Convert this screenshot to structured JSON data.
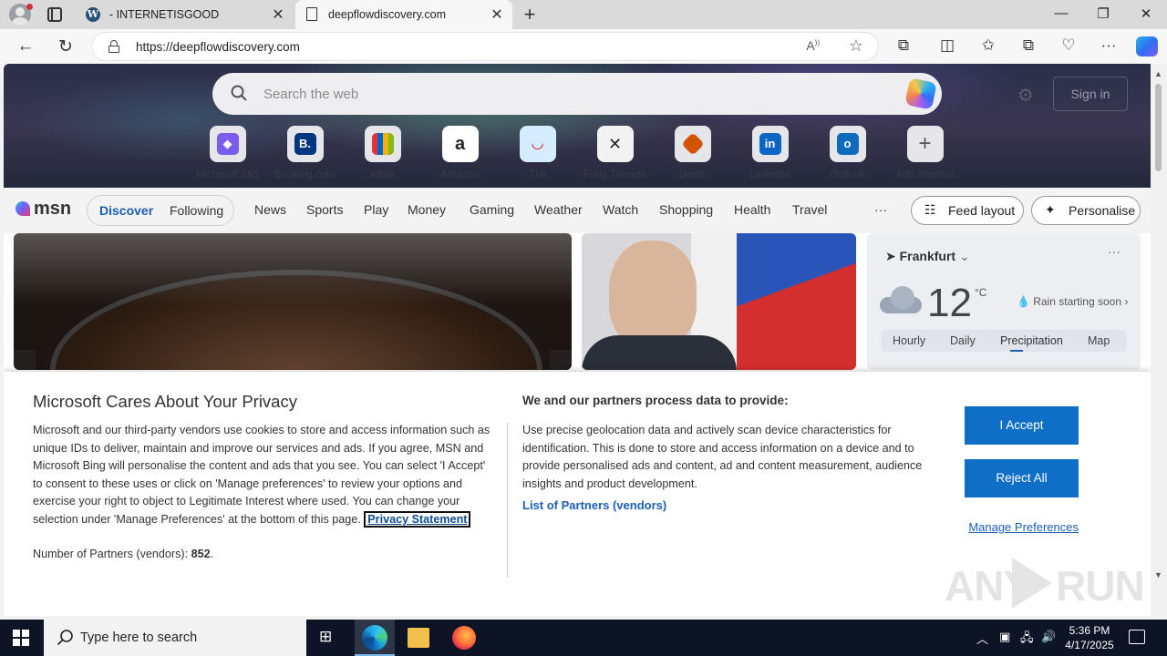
{
  "browser": {
    "tabs": [
      {
        "title": "- INTERNETISGOOD",
        "favicon": "wordpress-icon"
      },
      {
        "title": "deepflowdiscovery.com",
        "favicon": "page-icon"
      }
    ],
    "address_url": "https://deepflowdiscovery.com",
    "window_controls": {
      "minimize": "—",
      "restore": "❐",
      "close": "✕"
    }
  },
  "msn": {
    "search_placeholder": "Search the web",
    "sign_in_label": "Sign in",
    "shortcuts": [
      {
        "label": "Microsoft 365",
        "glyph": "◆",
        "color": "#7a5cf0"
      },
      {
        "label": "Booking.com",
        "glyph": "B.",
        "color": "#003580"
      },
      {
        "label": "eBay",
        "glyph": "▦",
        "color": "#e53238"
      },
      {
        "label": "Amazon",
        "glyph": "a",
        "color": "#222222"
      },
      {
        "label": "TUI",
        "glyph": "◡",
        "color": "#1e90ff"
      },
      {
        "label": "Forty Thieves",
        "glyph": "✕",
        "color": "#333333"
      },
      {
        "label": "Deals",
        "glyph": "◆",
        "color": "#d35400"
      },
      {
        "label": "LinkedIn",
        "glyph": "in",
        "color": "#0a66c2"
      },
      {
        "label": "Outlook",
        "glyph": "o",
        "color": "#0f6cbd"
      },
      {
        "label": "Add shortcut",
        "glyph": "+",
        "color": "#e5e5ea"
      }
    ],
    "logo_text": "msn",
    "feed_tabs": {
      "discover": "Discover",
      "following": "Following"
    },
    "nav_items": [
      "News",
      "Sports",
      "Play",
      "Money",
      "Gaming",
      "Weather",
      "Watch",
      "Shopping",
      "Health",
      "Travel"
    ],
    "more_label": "···",
    "feed_layout_label": "Feed layout",
    "personalise_label": "Personalise",
    "weather": {
      "location": "Frankfurt",
      "temperature": "12",
      "unit": "°C",
      "forecast_note": "Rain starting soon",
      "tabs": [
        "Hourly",
        "Daily",
        "Precipitation",
        "Map"
      ],
      "selected_tab": "Precipitation"
    }
  },
  "privacy": {
    "title": "Microsoft Cares About Your Privacy",
    "body": "Microsoft and our third-party vendors use cookies to store and access information such as unique IDs to deliver, maintain and improve our services and ads. If you agree, MSN and Microsoft Bing will personalise the content and ads that you see. You can select 'I Accept' to consent to these uses or click on 'Manage preferences' to review your options and exercise your right to object to Legitimate Interest where used.  You can change your selection under 'Manage Preferences' at the bottom of this page.",
    "privacy_link": "Privacy Statement",
    "partners_label": "Number of Partners (vendors):",
    "partners_count": "852",
    "partners_suffix": ".",
    "right_heading": "We and our partners process data to provide:",
    "right_body": "Use precise geolocation data and actively scan device characteristics for identification. This is done to store and access information on a device and to provide personalised ads and content, ad and content measurement, audience insights and product development.",
    "vendors_link": "List of Partners (vendors)",
    "accept_label": "I Accept",
    "reject_label": "Reject All",
    "manage_label": "Manage Preferences"
  },
  "watermark": {
    "left": "ANY",
    "right": "RUN"
  },
  "taskbar": {
    "search_placeholder": "Type here to search",
    "time": "5:36 PM",
    "date": "4/17/2025"
  }
}
